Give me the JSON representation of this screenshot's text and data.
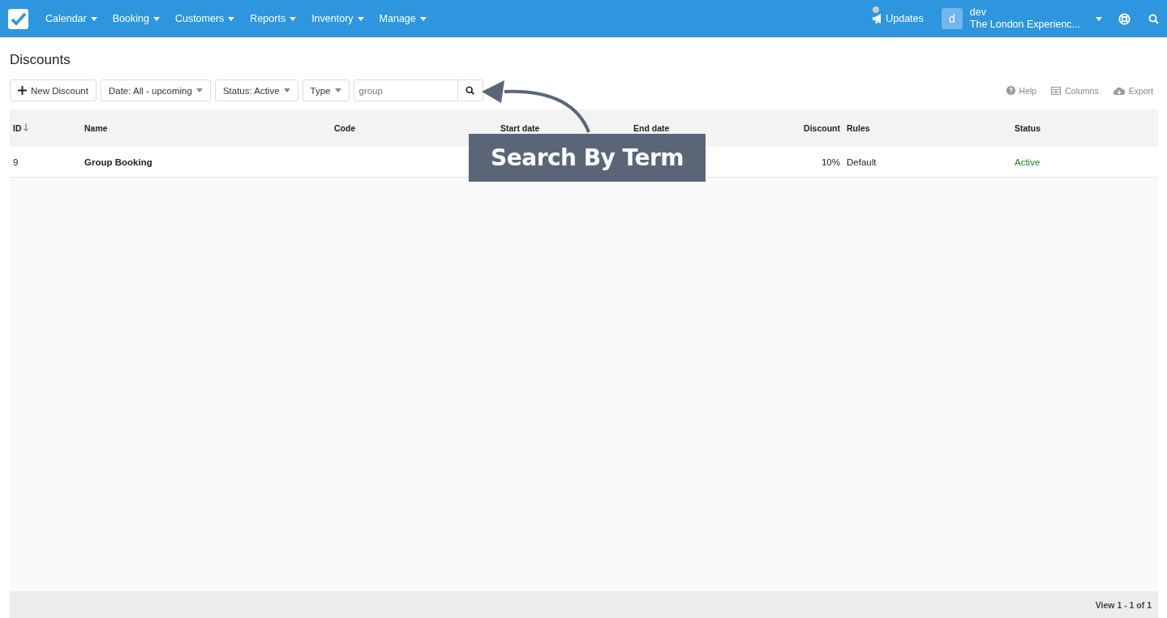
{
  "navbar": {
    "menus": [
      "Calendar",
      "Booking",
      "Customers",
      "Reports",
      "Inventory",
      "Manage"
    ],
    "updates": "Updates",
    "user": {
      "avatar": "d",
      "name": "dev",
      "company": "The London Experienc..."
    }
  },
  "page": {
    "title": "Discounts"
  },
  "toolbar": {
    "new_button": "New Discount",
    "filters": [
      "Date: All - upcoming",
      "Status: Active",
      "Type"
    ],
    "search": {
      "value": "group"
    },
    "actions": [
      "Help",
      "Columns",
      "Export"
    ]
  },
  "table": {
    "columns": [
      {
        "label": "ID",
        "sorted": true
      },
      {
        "label": "Name",
        "sorted": false
      },
      {
        "label": "Code",
        "sorted": false
      },
      {
        "label": "Start date",
        "sorted": false
      },
      {
        "label": "End date",
        "sorted": false
      },
      {
        "label": "Discount",
        "sorted": false
      },
      {
        "label": "Rules",
        "sorted": false
      },
      {
        "label": "Status",
        "sorted": false
      }
    ],
    "rows": [
      {
        "id": "9",
        "name": "Group Booking",
        "discount": "10%",
        "rules": "Default",
        "status": "Active",
        "color": "#118a11"
      }
    ]
  },
  "footer": {
    "pager": "View 1 - 1 of 1"
  },
  "callout": {
    "text": "Search By Term"
  }
}
